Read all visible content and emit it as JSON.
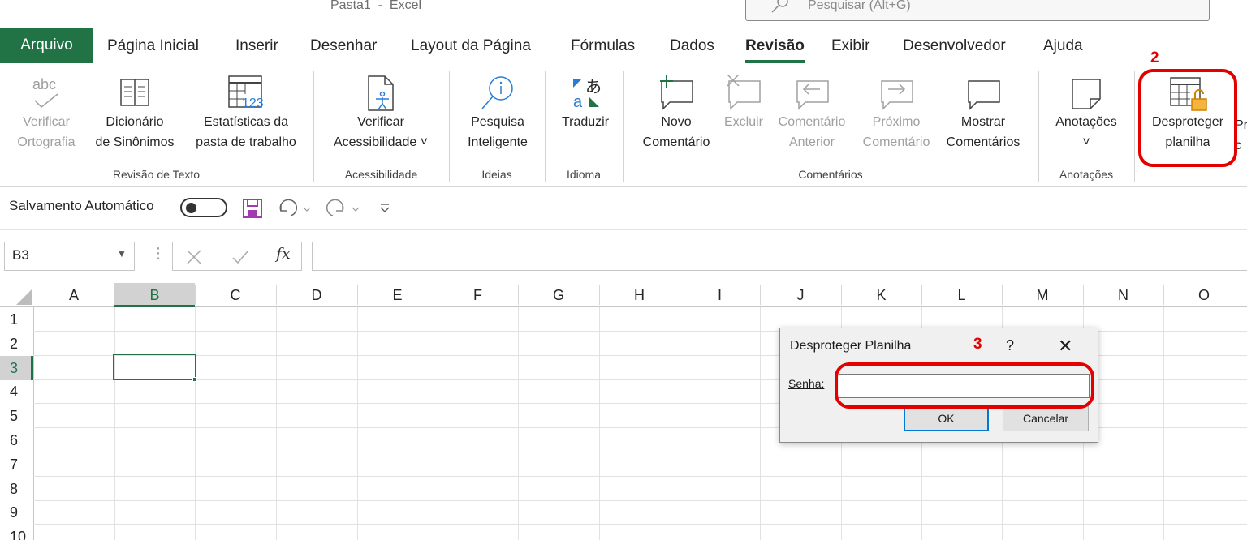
{
  "window": {
    "title": "Pasta1  -  Excel",
    "search_placeholder": "Pesquisar (Alt+G)"
  },
  "tabs": [
    "Arquivo",
    "Página Inicial",
    "Inserir",
    "Desenhar",
    "Layout da Página",
    "Fórmulas",
    "Dados",
    "Revisão",
    "Exibir",
    "Desenvolvedor",
    "Ajuda"
  ],
  "active_tab": "Revisão",
  "ribbon": {
    "verificar_ortografia": [
      "Verificar",
      "Ortografia"
    ],
    "dicionario": [
      "Dicionário",
      "de Sinônimos"
    ],
    "estatisticas": [
      "Estatísticas da",
      "pasta de trabalho"
    ],
    "verificar_acessibilidade": [
      "Verificar",
      "Acessibilidade ˅"
    ],
    "pesquisa_inteligente": [
      "Pesquisa",
      "Inteligente"
    ],
    "traduzir": "Traduzir",
    "novo_comentario": [
      "Novo",
      "Comentário"
    ],
    "excluir": "Excluir",
    "comentario_anterior": [
      "Comentário",
      "Anterior"
    ],
    "proximo_comentario": [
      "Próximo",
      "Comentário"
    ],
    "mostrar_comentarios": [
      "Mostrar",
      "Comentários"
    ],
    "anotacoes": "Anotações",
    "anotacoes_chevron": "˅",
    "desproteger_planilha": [
      "Desproteger",
      "planilha"
    ],
    "cut_off_label_1": "Pr",
    "cut_off_label_2": "c",
    "groups": {
      "revisao_texto": "Revisão de Texto",
      "acessibilidade": "Acessibilidade",
      "ideias": "Ideias",
      "idioma": "Idioma",
      "comentarios": "Comentários",
      "anotacoes": "Anotações"
    }
  },
  "quick_access": {
    "autosave_label": "Salvamento Automático",
    "autosave_on": false
  },
  "formula_bar": {
    "name_box": "B3",
    "fx_label": "fx",
    "formula": ""
  },
  "grid": {
    "columns": [
      "A",
      "B",
      "C",
      "D",
      "E",
      "F",
      "G",
      "H",
      "I",
      "J",
      "K",
      "L",
      "M",
      "N",
      "O"
    ],
    "rows": [
      "1",
      "2",
      "3",
      "4",
      "5",
      "6",
      "7",
      "8",
      "9",
      "10"
    ],
    "selected_column": "B",
    "selected_row": "3"
  },
  "dialog": {
    "title": "Desproteger Planilha",
    "help": "?",
    "close": "✕",
    "password_label": "Senha:",
    "password_value": "",
    "ok_label": "OK",
    "cancel_label": "Cancelar"
  },
  "annotations": {
    "step2": "2",
    "step3": "3",
    "color": "#e50000"
  },
  "colors": {
    "excel_green": "#217346",
    "accent_blue": "#0078d4"
  }
}
